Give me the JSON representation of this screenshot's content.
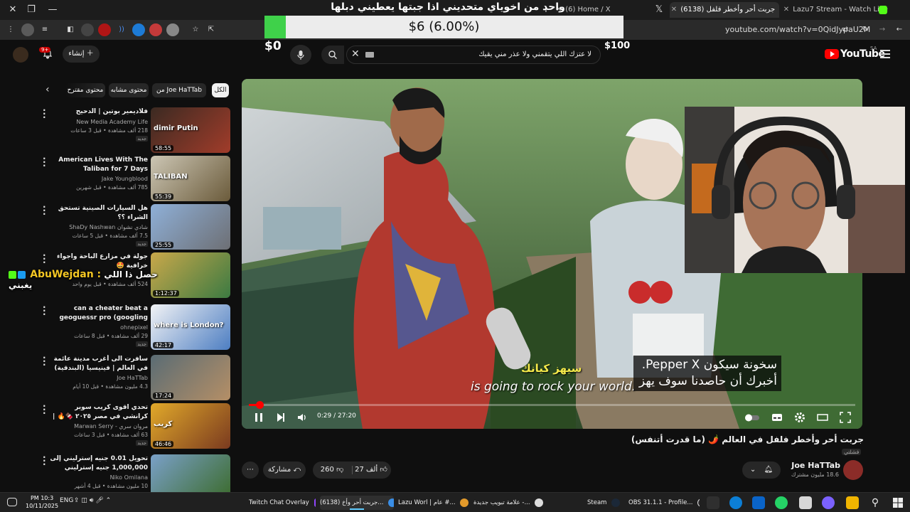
{
  "browser": {
    "tabs": [
      {
        "label": "Lazu7 Stream - Watch Live on K",
        "active": false
      },
      {
        "label": "(6138) جربت أحر وأخطر فلفل",
        "active": true
      },
      {
        "label": "(6) Home / X",
        "active": false
      }
    ],
    "url": "youtube.com/watch?v=0QidJypaU2M"
  },
  "stream_overlay": {
    "title": "واحد من اخوياي متحديني اذا جبتها يعطيني دبلها",
    "donation_label": "$6 (6.00%)",
    "donation_fraction": 0.06,
    "donation_min": "$0",
    "donation_max": "$100",
    "chat": {
      "user": "AbuWejdan :",
      "message_line1": "حصل ذا اللي",
      "message_line2": "يغبني"
    }
  },
  "youtube": {
    "logo": "YouTube",
    "logo_region": "SA",
    "search_query": "لا عتزك اللي يتقمني ولا عذر مني يقيك",
    "create_label": "إنشاء",
    "notif_count": "9+",
    "chips": [
      "الكل",
      "من Joe HaTTab",
      "محتوى مشابه",
      "محتوى مقترح"
    ],
    "recommendations": [
      {
        "title": "فلاديمير بوتين | الدحيح",
        "channel": "New Media Academy Life",
        "meta": "218 ألف مشاهدة • قبل 3 ساعات",
        "new": "جديد",
        "duration": "58:55",
        "thumb_text": "dimir Putin"
      },
      {
        "title": "American Lives With The Taliban for 7 Days",
        "channel": "Jake Youngblood",
        "meta": "785 ألف مشاهدة • قبل شهرين",
        "new": "",
        "duration": "55:39",
        "thumb_text": "TALIBAN"
      },
      {
        "title": "هل السيارات الصينية تستحق الشراء ؟؟",
        "channel": "ShaDy Nashwan شادي نشوان",
        "meta": "7.5 ألف مشاهدة • قبل 5 ساعات",
        "new": "جديد",
        "duration": "25:55",
        "thumb_text": ""
      },
      {
        "title": "جولة في مزارع الباحة واجواء خرافية 🤩",
        "channel": "",
        "meta": "524 ألف مشاهدة • قبل يوم واحد",
        "new": "",
        "duration": "1:12:37",
        "thumb_text": ""
      },
      {
        "title": "can a cheater beat a geoguessr pro (googling every guess)",
        "channel": "ohnepixel",
        "meta": "29 ألف مشاهدة • قبل 8 ساعات",
        "new": "جديد",
        "duration": "42:17",
        "thumb_text": "where is London?"
      },
      {
        "title": "سافرت الى أغرب مدينة عائمة في العالم | فينيسيا (البندقية) 🇮🇹",
        "channel": "Joe HaTTab",
        "meta": "4.3 مليون مشاهدة • قبل 10 أيام",
        "new": "",
        "duration": "17:24",
        "thumb_text": ""
      },
      {
        "title": "تحدي اقوى كريب سوبر كرانشي في مصر ٢٠٢٥ 🍫🔥 | اضرب مع سري",
        "channel": "Marwan Serry - مروان سري",
        "meta": "63 ألف مشاهدة • قبل 3 ساعات",
        "new": "جديد",
        "duration": "46:46",
        "thumb_text": "كريب"
      },
      {
        "title": "تحويل 0.01 جنيه إسترليني إلى 1,000,000 جنيه إسترليني",
        "channel": "Niko Omilana",
        "meta": "10 مليون مشاهدة • قبل 4 أشهر",
        "new": "",
        "duration": "55:31",
        "thumb_text": ""
      }
    ],
    "video": {
      "title": "جربت أحر وأخطر فلفل في العالم 🌶️ (ما قدرت أتنفس)",
      "tag": "فشلتي",
      "channel_name": "Joe HaTTab",
      "channel_subs": "18.6 مليون مشترك",
      "likes": "27 ألف",
      "dislikes": "260",
      "share_label": "مشاركة",
      "time_display": "0:29 / 27:20",
      "progress_fraction": 0.018,
      "subtitle_line1": "سخونة سيكون Pepper X.",
      "subtitle_line2": "أخبرك أن حاصدنا سوف يهز",
      "burned_sub_ar": "سيهز كيانك",
      "burned_sub_en": "is going to rock your world."
    }
  },
  "taskbar": {
    "clock_time": "PM 10:3",
    "clock_date": "10/11/2025",
    "lang": "ENG",
    "apps": [
      {
        "label": "Twitch Chat Overlay",
        "active": false
      },
      {
        "label": "(6138) جربت أحر وأخ...",
        "active": true
      },
      {
        "label": "Lazu Worl | عام #...",
        "active": false
      },
      {
        "label": "علامة تبويب جديدة -...",
        "active": false
      },
      {
        "label": "Steam",
        "active": false
      },
      {
        "label": "OBS 31.1.1 - Profile...",
        "active": false
      }
    ]
  }
}
